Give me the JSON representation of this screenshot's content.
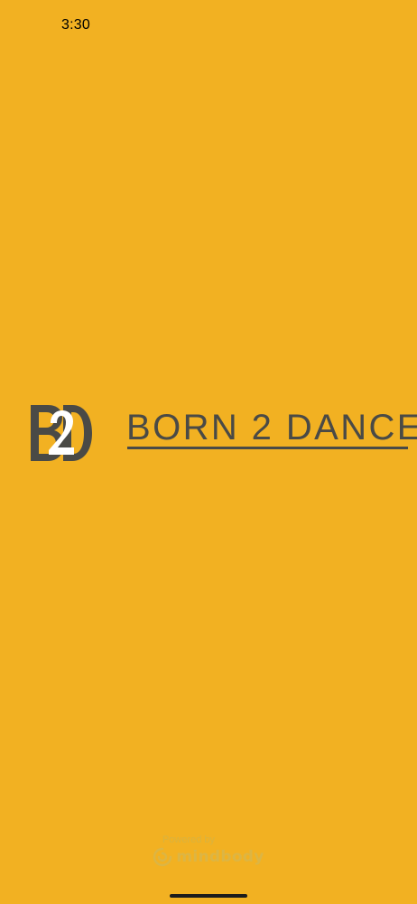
{
  "colors": {
    "background": "#F2B122",
    "logo_dark": "#4A4A46",
    "logo_accent": "#FFFFFF"
  },
  "status_bar": {
    "time": "3:30"
  },
  "logo": {
    "monogram": "B2D",
    "wordmark": "BORN 2 DANCE"
  },
  "footer": {
    "powered_by": "Powered by",
    "brand": "mindbody",
    "brand_icon": "mindbody-logo-icon"
  }
}
